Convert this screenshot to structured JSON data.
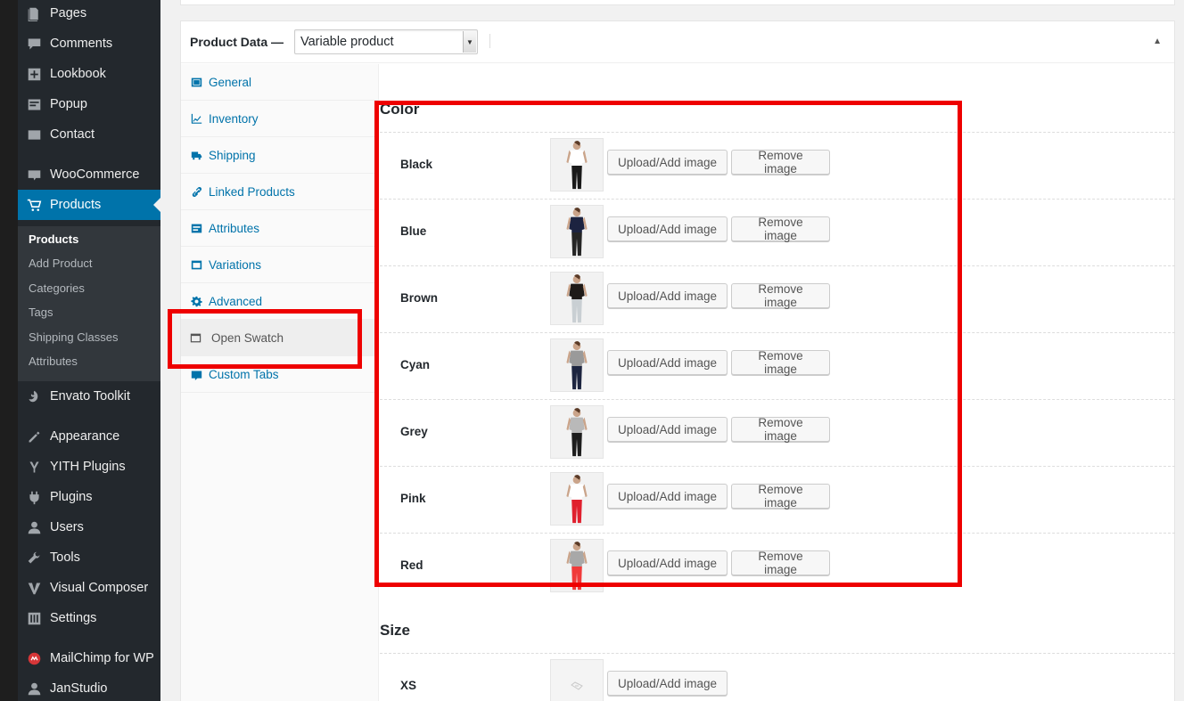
{
  "sidebar": {
    "items": [
      {
        "label": "Pages",
        "icon": "pages-icon"
      },
      {
        "label": "Comments",
        "icon": "comments-icon"
      },
      {
        "label": "Lookbook",
        "icon": "lookbook-icon"
      },
      {
        "label": "Popup",
        "icon": "popup-icon"
      },
      {
        "label": "Contact",
        "icon": "contact-icon"
      },
      {
        "label": "WooCommerce",
        "icon": "woocommerce-icon"
      },
      {
        "label": "Products",
        "icon": "cart-icon",
        "active": true
      },
      {
        "label": "Envato Toolkit",
        "icon": "envato-icon"
      },
      {
        "label": "Appearance",
        "icon": "appearance-icon"
      },
      {
        "label": "YITH Plugins",
        "icon": "yith-icon"
      },
      {
        "label": "Plugins",
        "icon": "plugins-icon"
      },
      {
        "label": "Users",
        "icon": "users-icon"
      },
      {
        "label": "Tools",
        "icon": "tools-icon"
      },
      {
        "label": "Visual Composer",
        "icon": "visual-composer-icon"
      },
      {
        "label": "Settings",
        "icon": "settings-icon"
      },
      {
        "label": "MailChimp for WP",
        "icon": "mailchimp-icon"
      },
      {
        "label": "JanStudio",
        "icon": "janstudio-icon"
      }
    ],
    "submenu": [
      "Products",
      "Add Product",
      "Categories",
      "Tags",
      "Shipping Classes",
      "Attributes"
    ]
  },
  "product_data": {
    "title": "Product Data —",
    "type_value": "Variable product",
    "collapse_icon": "triangle-up-icon"
  },
  "tabs": [
    {
      "label": "General",
      "icon": "general-icon"
    },
    {
      "label": "Inventory",
      "icon": "inventory-icon"
    },
    {
      "label": "Shipping",
      "icon": "shipping-icon"
    },
    {
      "label": "Linked Products",
      "icon": "link-icon"
    },
    {
      "label": "Attributes",
      "icon": "attributes-icon"
    },
    {
      "label": "Variations",
      "icon": "variations-icon"
    },
    {
      "label": "Advanced",
      "icon": "gear-icon"
    },
    {
      "label": "Open Swatch",
      "icon": "window-icon",
      "active": true
    },
    {
      "label": "Custom Tabs",
      "icon": "custom-tabs-icon"
    }
  ],
  "swatches": {
    "sections": [
      {
        "title": "Color",
        "rows": [
          {
            "label": "Black",
            "top": "#ffffff",
            "bottom": "#1a1a1a",
            "has_image": true
          },
          {
            "label": "Blue",
            "top": "#1c2340",
            "bottom": "#252525",
            "has_image": true
          },
          {
            "label": "Brown",
            "top": "#1e1a18",
            "bottom": "#c9cfd3",
            "has_image": true
          },
          {
            "label": "Cyan",
            "top": "#9a9a9a",
            "bottom": "#1d2540",
            "has_image": true
          },
          {
            "label": "Grey",
            "top": "#b9b9b9",
            "bottom": "#1e1e1e",
            "has_image": true
          },
          {
            "label": "Pink",
            "top": "#ffffff",
            "bottom": "#e0202e",
            "has_image": true
          },
          {
            "label": "Red",
            "top": "#a8a8a8",
            "bottom": "#f03a3a",
            "has_image": true
          }
        ]
      },
      {
        "title": "Size",
        "rows": [
          {
            "label": "XS",
            "has_image": false
          }
        ]
      }
    ],
    "upload_label": "Upload/Add image",
    "remove_label": "Remove image"
  },
  "colors": {
    "accent": "#0073aa",
    "highlight": "#e00000",
    "sidebar_bg": "#23282d"
  }
}
